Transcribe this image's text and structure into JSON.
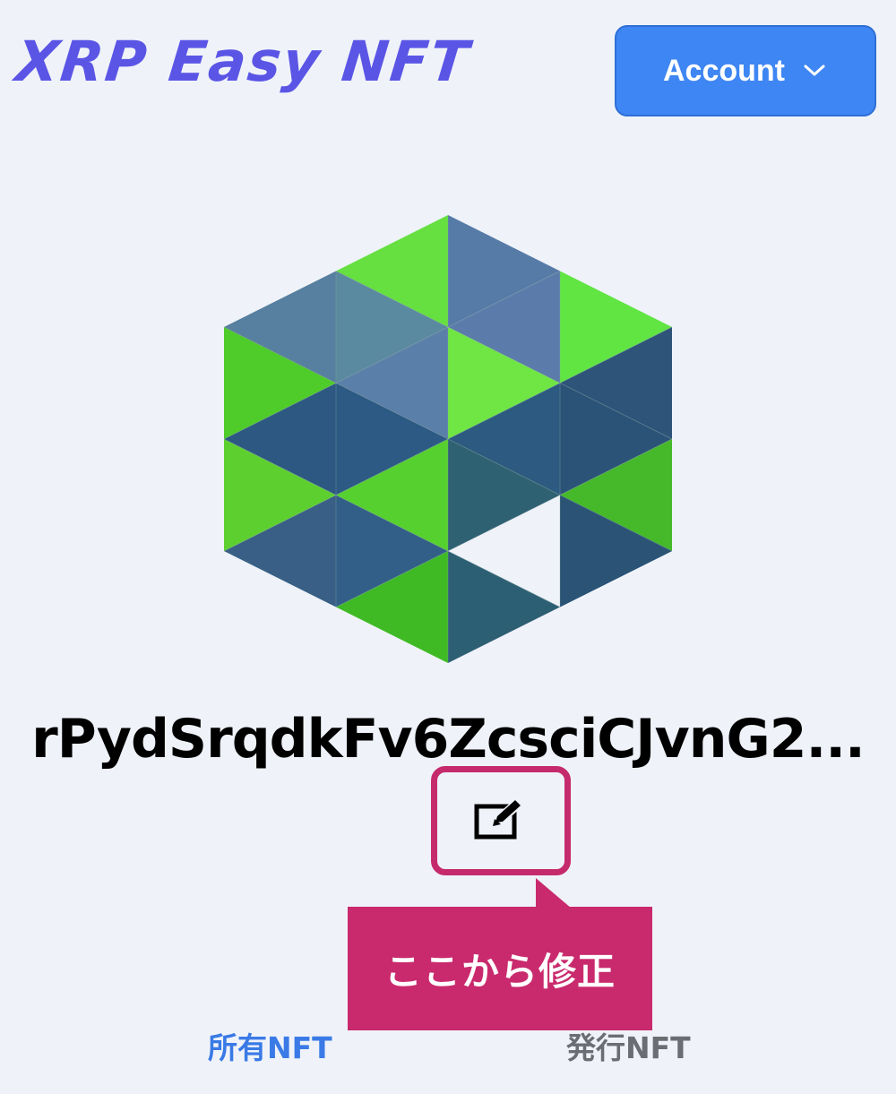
{
  "header": {
    "logo_text": "XRP Easy NFT",
    "account_button": {
      "label": "Account",
      "icon": "chevron-down-icon"
    }
  },
  "profile": {
    "address": "rPydSrqdkFv6ZcsciCJvnG2...",
    "edit_icon": "edit-icon"
  },
  "annotation": {
    "callout_text": "ここから修正"
  },
  "tabs": [
    {
      "label": "所有NFT",
      "active": true
    },
    {
      "label": "発行NFT",
      "active": false
    }
  ],
  "colors": {
    "background": "#eff3f9",
    "logo": "#5b55e6",
    "account_button": "#3e86f3",
    "highlight": "#c92a6d",
    "tab_active": "#3a7ae6",
    "tab_inactive": "#6a6d72"
  }
}
